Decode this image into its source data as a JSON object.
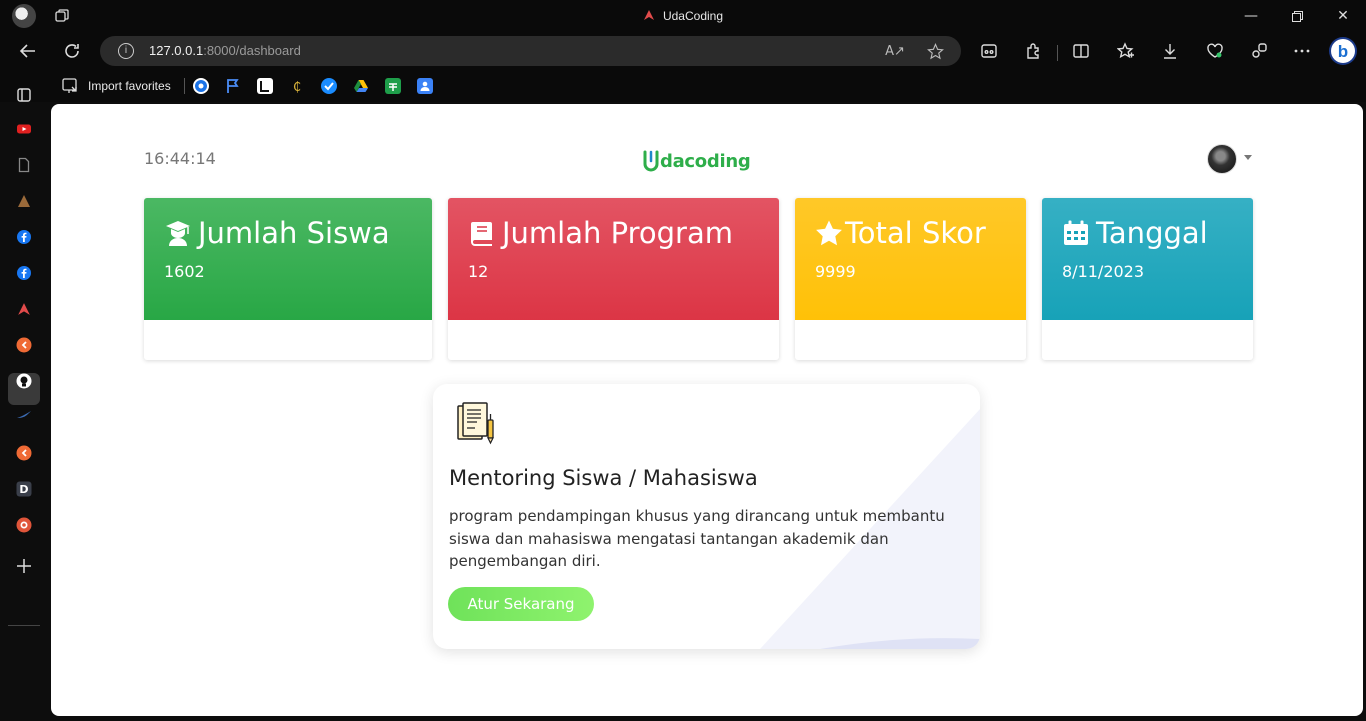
{
  "browser": {
    "window_title": "UdaCoding",
    "url_host": "127.0.0.1",
    "url_rest": ":8000/dashboard",
    "favorites_label": "Import favorites"
  },
  "header": {
    "clock": "16:44:14",
    "logo_text": "dacoding"
  },
  "stats": [
    {
      "title": "Jumlah Siswa",
      "value": "1602",
      "icon": "user-graduate-icon",
      "color": "#28a745"
    },
    {
      "title": "Jumlah Program",
      "value": "12",
      "icon": "book-icon",
      "color": "#dc3545"
    },
    {
      "title": "Total Skor",
      "value": "9999",
      "icon": "star-icon",
      "color": "#ffc107"
    },
    {
      "title": "Tanggal",
      "value": "8/11/2023",
      "icon": "calendar-icon",
      "color": "#17a2b8"
    }
  ],
  "card": {
    "title": "Mentoring Siswa / Mahasiswa",
    "description": "program pendampingan khusus yang dirancang untuk membantu siswa dan mahasiswa mengatasi tantangan akademik dan pengembangan diri.",
    "button": "Atur Sekarang"
  }
}
